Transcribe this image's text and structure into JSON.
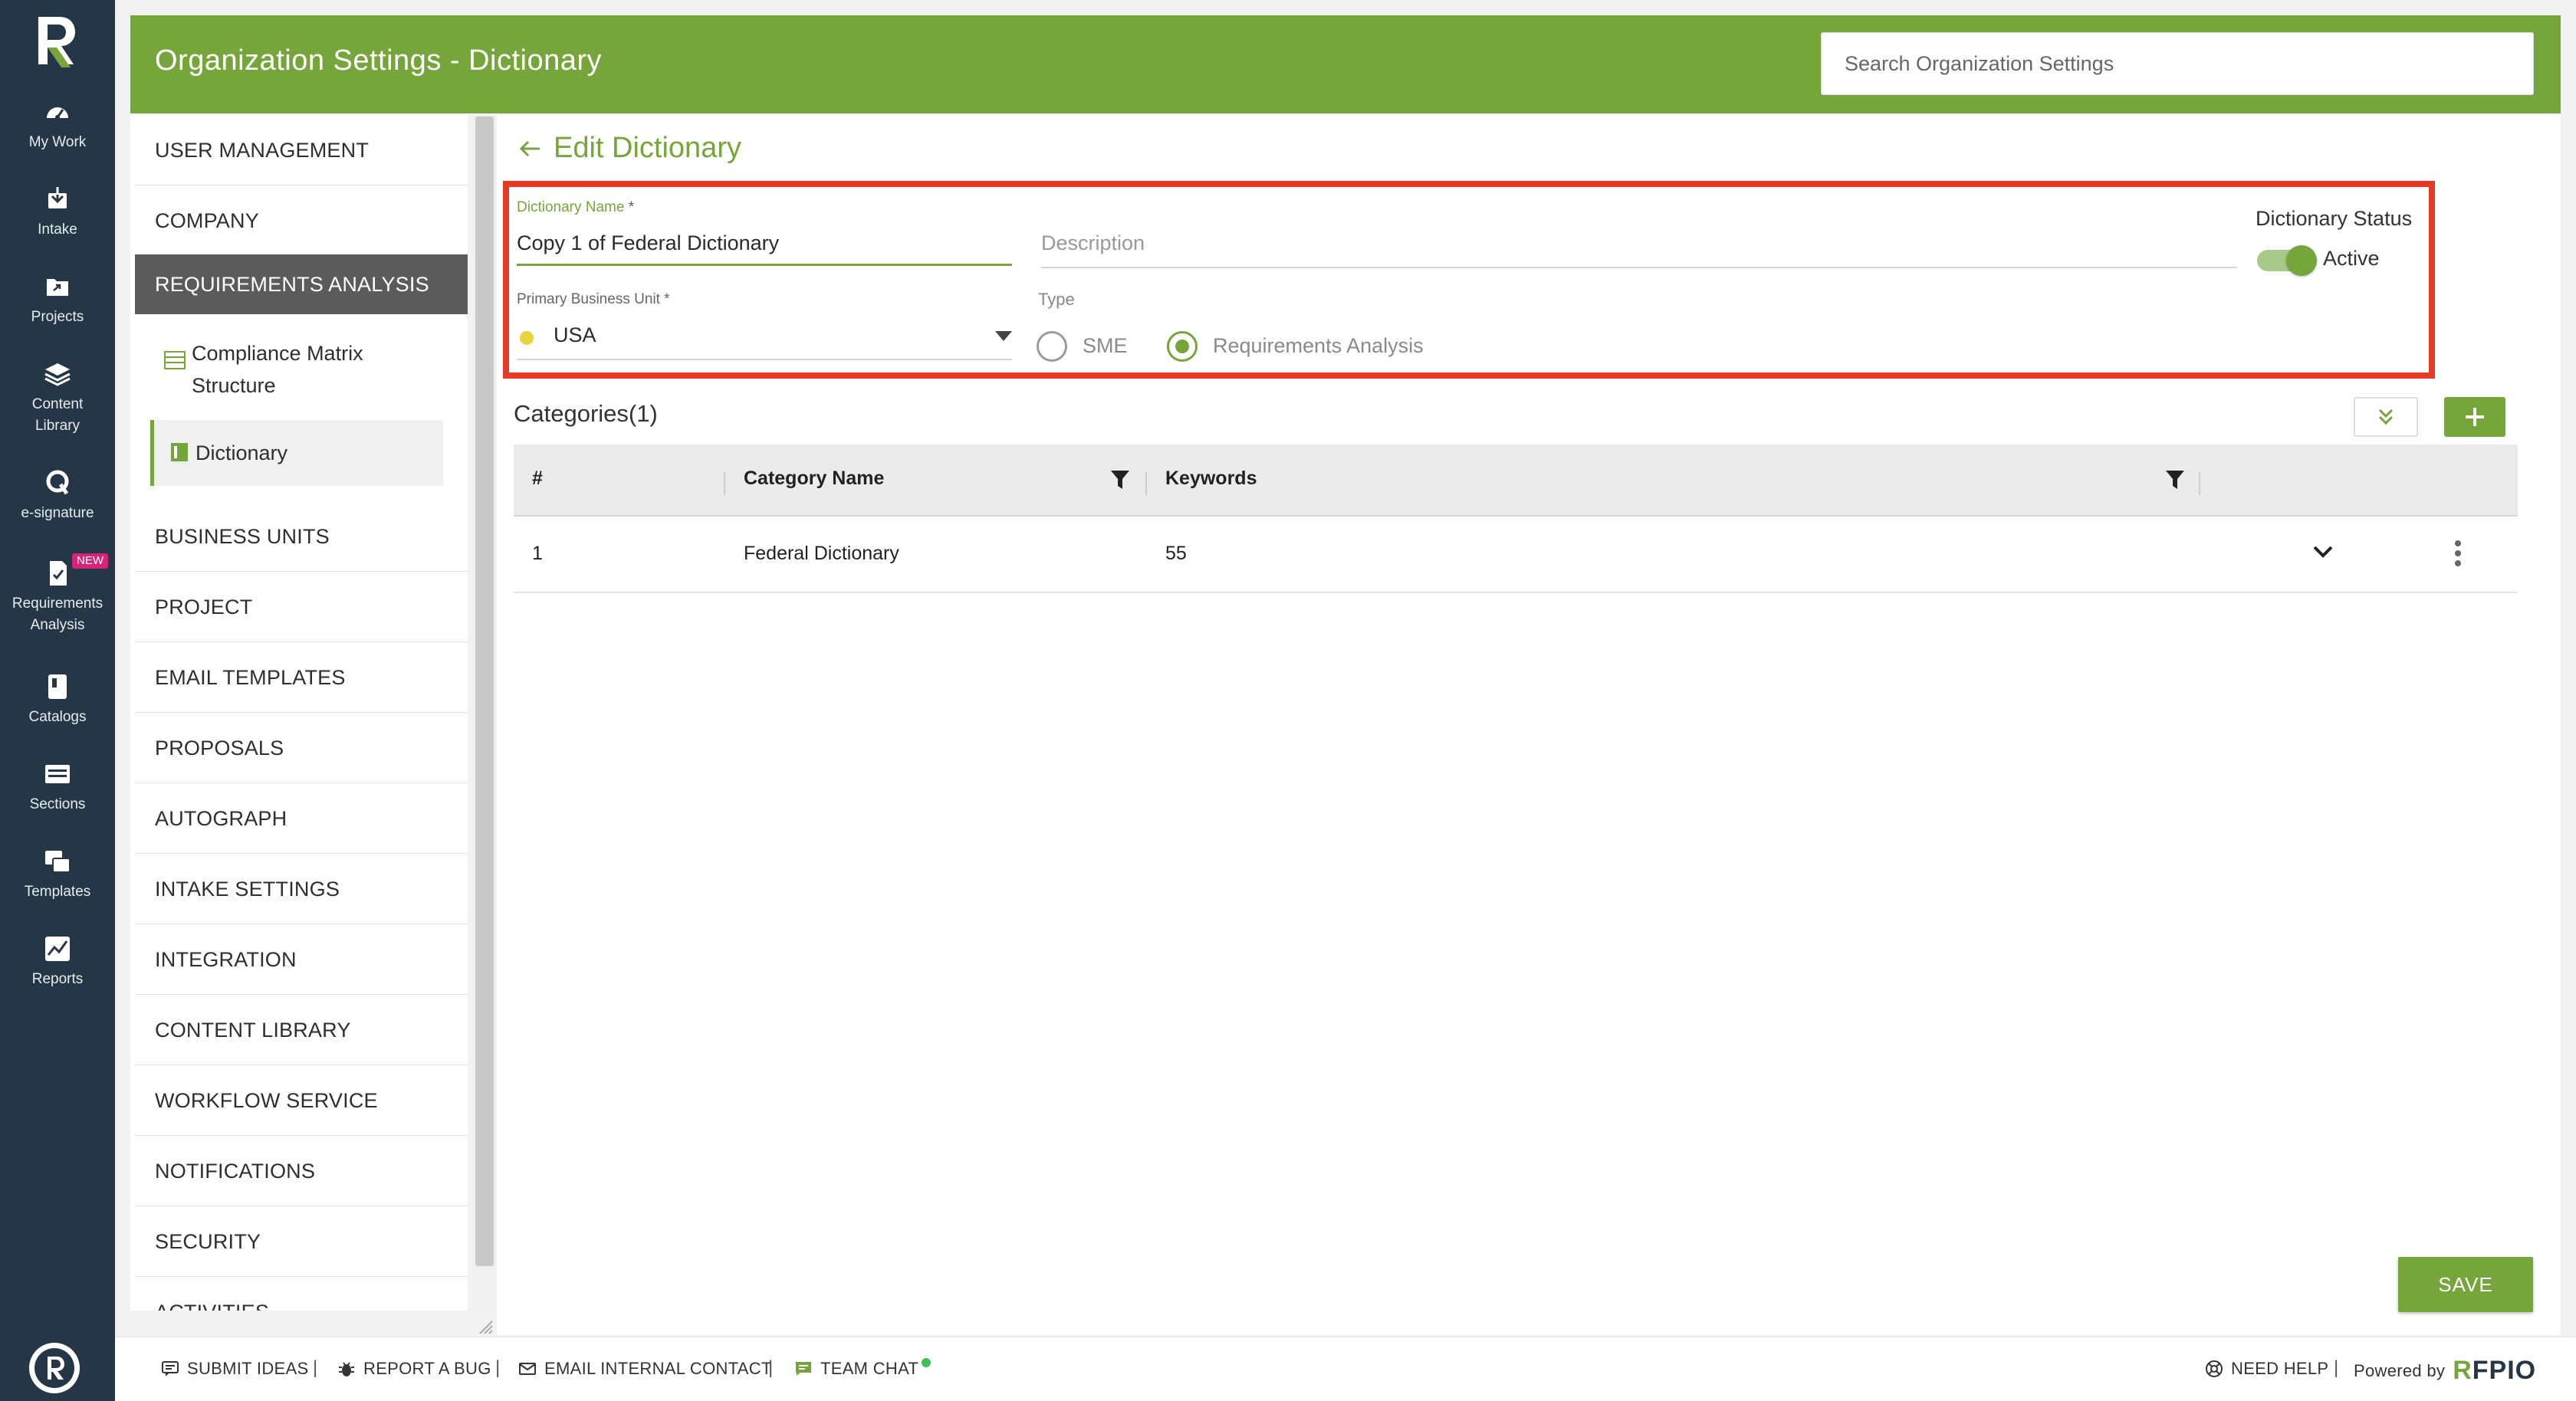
{
  "header": {
    "title": "Organization Settings - Dictionary",
    "search_placeholder": "Search Organization Settings"
  },
  "rail": {
    "items": [
      {
        "label": "My Work",
        "icon": "dashboard-icon"
      },
      {
        "label": "Intake",
        "icon": "intake-icon"
      },
      {
        "label": "Projects",
        "icon": "projects-icon"
      },
      {
        "label": "Content Library",
        "icon": "layers-icon"
      },
      {
        "label": "e-signature",
        "icon": "signature-icon"
      },
      {
        "label": "Requirements Analysis",
        "icon": "requirements-icon",
        "badge": "NEW"
      },
      {
        "label": "Catalogs",
        "icon": "book-icon"
      },
      {
        "label": "Sections",
        "icon": "sections-icon"
      },
      {
        "label": "Templates",
        "icon": "templates-icon"
      },
      {
        "label": "Reports",
        "icon": "reports-icon"
      }
    ]
  },
  "nav": {
    "items": [
      "USER MANAGEMENT",
      "COMPANY",
      "REQUIREMENTS ANALYSIS",
      "BUSINESS UNITS",
      "PROJECT",
      "EMAIL TEMPLATES",
      "PROPOSALS",
      "AUTOGRAPH",
      "INTAKE SETTINGS",
      "INTEGRATION",
      "CONTENT LIBRARY",
      "WORKFLOW SERVICE",
      "NOTIFICATIONS",
      "SECURITY",
      "ACTIVITIES"
    ],
    "sub_items": [
      "Compliance Matrix Structure",
      "Dictionary"
    ],
    "sub_item_1_line1": "Compliance Matrix",
    "sub_item_1_line2": "Structure"
  },
  "edit": {
    "back_label": "Edit Dictionary",
    "name_label": "Dictionary Name",
    "name_value": "Copy 1 of Federal Dictionary",
    "description_placeholder": "Description",
    "status_label": "Dictionary Status",
    "status_value": "Active",
    "bu_label": "Primary Business Unit",
    "bu_value": "USA",
    "type_label": "Type",
    "type_options": [
      "SME",
      "Requirements Analysis"
    ],
    "type_selected": "Requirements Analysis",
    "required_mark": "*"
  },
  "categories": {
    "title": "Categories(1)",
    "columns": [
      "#",
      "Category Name",
      "Keywords"
    ],
    "rows": [
      {
        "num": "1",
        "name": "Federal Dictionary",
        "keywords": "55"
      }
    ]
  },
  "save_label": "SAVE",
  "footer": {
    "items": [
      "SUBMIT IDEAS",
      "REPORT A BUG",
      "EMAIL INTERNAL CONTACT",
      "TEAM CHAT",
      "NEED HELP"
    ],
    "powered_by": "Powered by",
    "brand_r": "R",
    "brand_rest": "FPIO"
  },
  "colors": {
    "accent": "#76a63b",
    "rail": "#253746",
    "highlight_frame": "#e53a26",
    "bu_dot": "#e8d43a"
  }
}
